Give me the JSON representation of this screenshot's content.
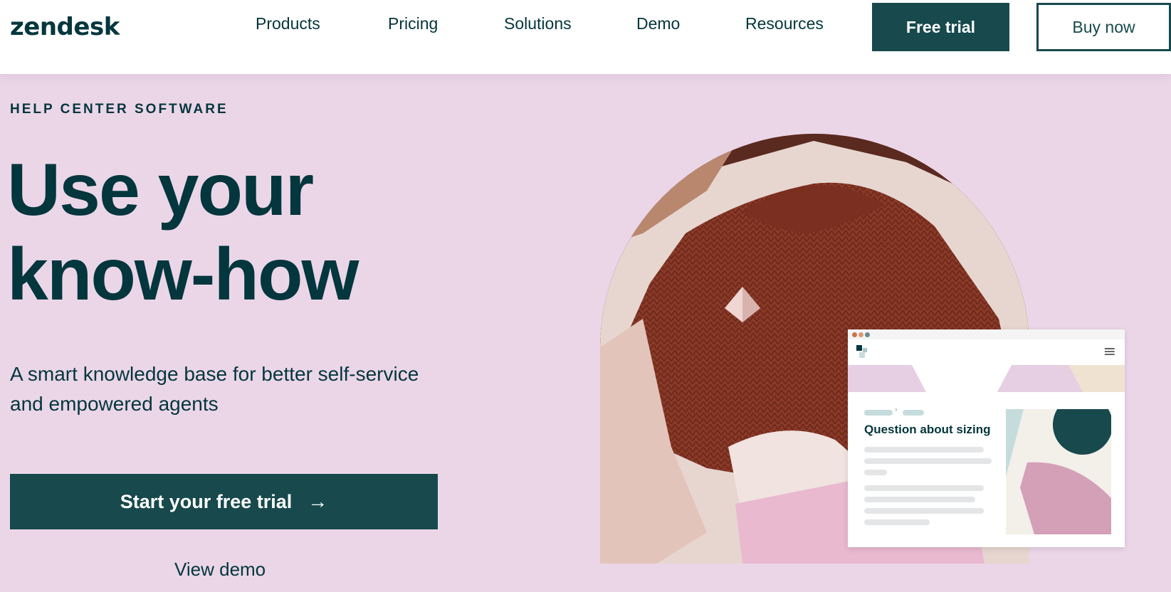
{
  "header": {
    "logo": "zendesk",
    "nav": [
      "Products",
      "Pricing",
      "Solutions",
      "Demo",
      "Resources"
    ],
    "free_trial_label": "Free trial",
    "buy_now_label": "Buy now"
  },
  "hero": {
    "eyebrow": "HELP CENTER SOFTWARE",
    "headline_line1": "Use your",
    "headline_line2": "know-how",
    "subhead_line1": "A smart knowledge base for better self-service",
    "subhead_line2": "and empowered agents",
    "cta_label": "Start your free trial",
    "cta_arrow": "→",
    "secondary_label": "View demo"
  },
  "card": {
    "title": "Question about sizing",
    "menu_icon": "≡"
  },
  "icons": {
    "arrow": "arrow-right-icon",
    "menu": "hamburger-menu-icon",
    "logo_mark": "site-logo-icon"
  },
  "colors": {
    "brand_dark": "#03363d",
    "button": "#17494d",
    "background": "#ebd6e8",
    "sweater": "#8a3d2a"
  }
}
